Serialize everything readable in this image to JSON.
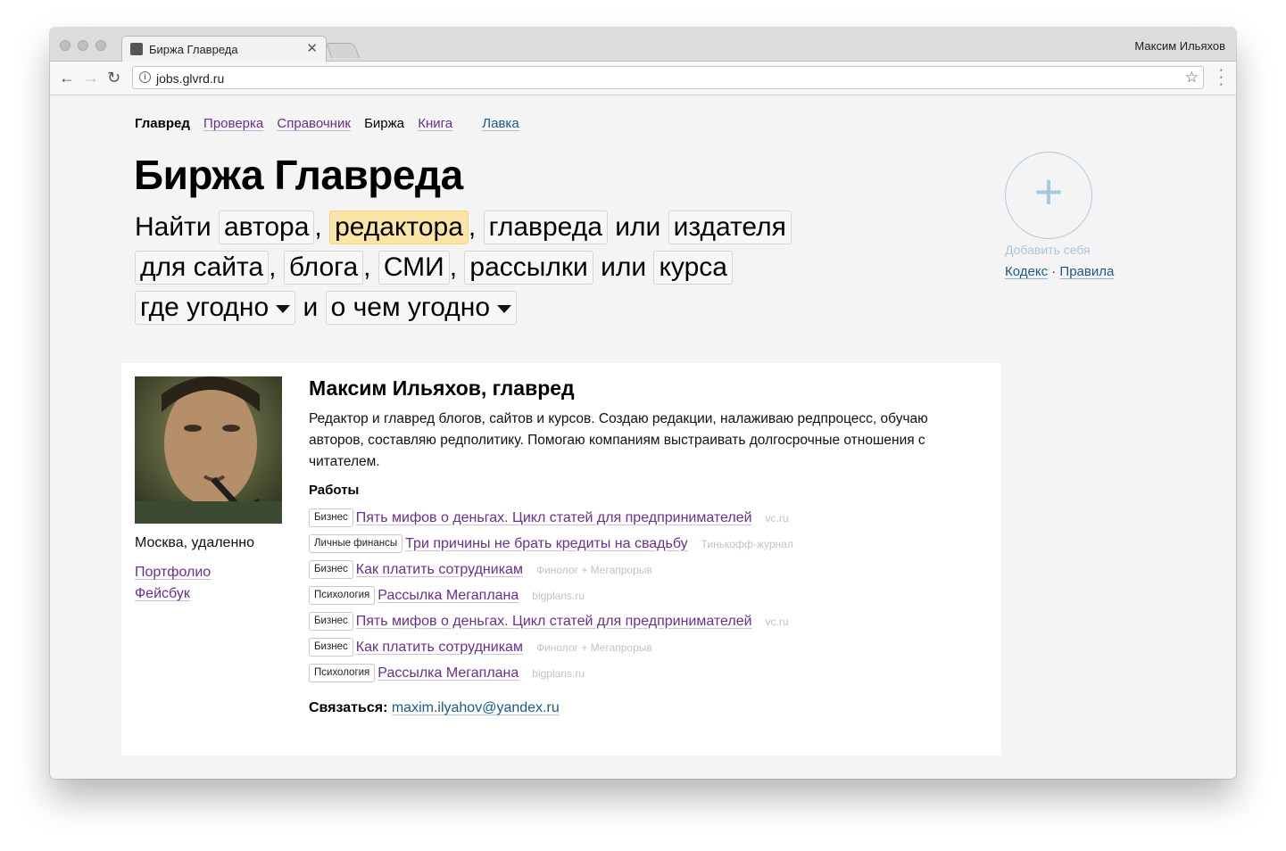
{
  "browser": {
    "tab_title": "Биржа Главреда",
    "profile_name": "Максим Ильяхов",
    "url": "jobs.glvrd.ru"
  },
  "site_nav": {
    "active": "Главред",
    "proverka": "Проверка",
    "spravochnik": "Справочник",
    "birzha": "Биржа",
    "kniga": "Книга",
    "lavka": "Лавка"
  },
  "page_title": "Биржа Главреда",
  "search": {
    "find": "Найти",
    "roles": [
      "автора",
      "редактора",
      "главреда",
      "издателя"
    ],
    "selected_role": "редактора",
    "platforms": [
      "для сайта",
      "блога",
      "СМИ",
      "рассылки",
      "курса"
    ],
    "comma": ",",
    "or": "или",
    "and": "и",
    "location": "где угодно",
    "topic": "о чем угодно"
  },
  "sidebar": {
    "add_label": "Добавить себя",
    "kodeks": "Кодекс",
    "separator": "·",
    "pravila": "Правила"
  },
  "profile": {
    "name": "Максим Ильяхов, главред",
    "bio": "Редактор и главред блогов, сайтов и курсов. Создаю редакции, налаживаю редпроцесс, обучаю авторов, составляю редполитику. Помогаю компаниям выстраивать долгосрочные отношения с читателем.",
    "location": "Москва, удаленно",
    "portfolio": "Портфолио",
    "facebook": "Фейсбук",
    "works_heading": "Работы",
    "works": [
      {
        "tag": "Бизнес",
        "title": "Пять мифов о деньгах. Цикл статей для предпринимателей",
        "source": "vc.ru"
      },
      {
        "tag": "Личные финансы",
        "title": "Три причины не брать кредиты на свадьбу",
        "source": "Тинькофф-журнал"
      },
      {
        "tag": "Бизнес",
        "title": "Как платить сотрудникам",
        "source": "Финолог + Мегапрорыв"
      },
      {
        "tag": "Психология",
        "title": "Рассылка Мегаплана",
        "source": "bigplans.ru"
      },
      {
        "tag": "Бизнес",
        "title": "Пять мифов о деньгах. Цикл статей для предпринимателей",
        "source": "vc.ru"
      },
      {
        "tag": "Бизнес",
        "title": "Как платить сотрудникам",
        "source": "Финолог + Мегапрорыв"
      },
      {
        "tag": "Психология",
        "title": "Рассылка Мегаплана",
        "source": "bigplans.ru"
      }
    ],
    "contact_label": "Связаться:",
    "email": "maxim.ilyahov@yandex.ru"
  },
  "colors": {
    "visited_link": "#6b2f8c",
    "blue_link": "#1a5a8a",
    "selected_chip": "#fbe5a6",
    "muted_source": "#c2c2c2"
  }
}
